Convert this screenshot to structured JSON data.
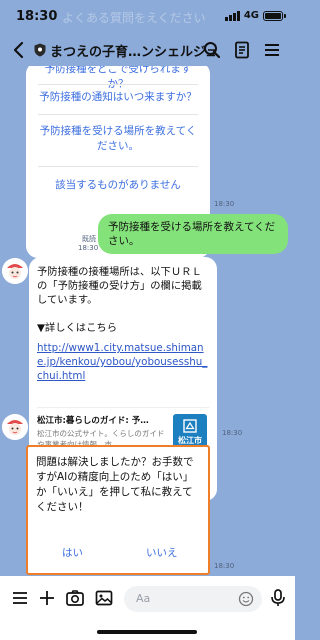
{
  "status": {
    "time": "18:30",
    "time_shadow": "よくある質問をえください",
    "network": "4G",
    "battery_level": 1.0
  },
  "header": {
    "title": "まつえの子育…ンシェルジュ",
    "icons": [
      "back-icon",
      "shield-icon",
      "search-icon",
      "notes-icon",
      "menu-icon"
    ]
  },
  "quick_replies": {
    "items": [
      "予防接種をどこで受けられますか？",
      "予防接種の通知はいつ来ますか？",
      "予防接種を受ける場所を教えてください。",
      "該当するものがありません"
    ],
    "time": "18:30"
  },
  "sent": {
    "read": "既読",
    "time": "18:30",
    "text": "予防接種を受ける場所を教えてください。"
  },
  "bot": {
    "intro": "予防接種の接種場所は、以下ＵＲＬの「予防接種の受け方」の欄に掲載しています。",
    "details": "▼詳しくはこちら",
    "link": "http://www1.city.matsue.shimane.jp/kenkou/yobou/yobousesshu_chui.html",
    "preview_title": "松江市:暮らしのガイド: 予…",
    "preview_desc": "松江市の公式サイト。くらしのガイドや事業者向け情報、市…",
    "preview_logo": "松江市",
    "time": "18:30"
  },
  "question": {
    "text": "問題は解決しましたか？お手数ですがAIの精度向上のため「はい」か「いいえ」を押して私に教えてください！",
    "yes": "はい",
    "no": "いいえ",
    "time": "18:30"
  },
  "inputbar": {
    "placeholder": "Aa",
    "icons": [
      "menu-lines-icon",
      "plus-icon",
      "camera-icon",
      "image-icon",
      "emoji-icon",
      "microphone-icon"
    ]
  },
  "colors": {
    "background": "#8cabd9",
    "sent_bubble": "#84e27a",
    "link": "#3d6fe0",
    "highlight_border": "#f07d28"
  }
}
